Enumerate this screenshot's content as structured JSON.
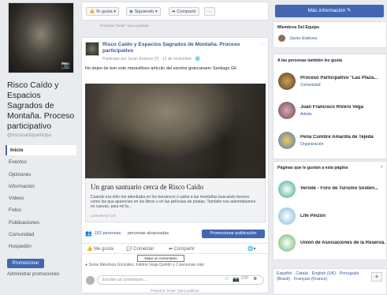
{
  "page": {
    "name": "Risco Caído y Espacios Sagrados de Montaña. Proceso participativo",
    "handle": "@riscocaidoparticipa"
  },
  "nav": [
    "Inicio",
    "Eventos",
    "Opiniones",
    "Información",
    "Vídeos",
    "Fotos",
    "Publicaciones",
    "Comunidad",
    "Hospedón"
  ],
  "left": {
    "promote": "Promocionar",
    "admin_promos": "Administrar promociones"
  },
  "topbar": {
    "like": "Te gusta ▾",
    "following": "Siguiendo ▾",
    "share": "Compartir",
    "more": "···"
  },
  "invite_hint": "Presiona \"Enter\" para publicar.",
  "post": {
    "title": "Risco Caído y Espacios Sagrados de Montaña. Proceso participativo",
    "meta": "Publicado por Javier Estévez [?] · 12 de noviembre · 🌐",
    "text": "No dejen de leer este maravilloso artículo del escritor grancanario Santiago Gil",
    "link_title": "Un gran santuario cerca de Risco Caído",
    "link_desc": "Cuando era niño me adentraba en los barrancos o subía a las montañas buscando tesoros como los que aparecían en los libros o en las películas de piratas. También nos adentrábamos en cuevas, para mí la...",
    "link_domain": "CANARIAS7.ES",
    "reach_count": "152 personas",
    "reach_label": "personas alcanzadas",
    "promote_pub": "Promocionar publicación",
    "like": "Me gusta",
    "comment": "Comentar",
    "share": "Compartir",
    "tooltip": "Dejar un comentario",
    "likers": "Sonia Mendoza González, Fátima Vega Quintín y 2 personas más",
    "comment_placeholder": "Escribe un comentario...",
    "invite_hint": "Presiona \"Enter\" para publicar."
  },
  "right": {
    "more_info": "Más información ✎",
    "team_head": "Miembros Del Equipo",
    "team_member": "Javier Estévez",
    "also_likes_head": "A las personas también les gusta",
    "also_likes": [
      {
        "name": "Proceso Participativo \"Las Plaza...",
        "sub": "Comunidad"
      },
      {
        "name": "Juan Francisco Rivero Vega",
        "sub": "Artista"
      },
      {
        "name": "Peña Cumbre Amarilla de Tejeda",
        "sub": "Organización"
      }
    ],
    "liked_by_head": "Páginas que le gustan a esta página",
    "liked_by": [
      {
        "name": "Verode - Foro de Turismo Sosten..."
      },
      {
        "name": "Life Pinzón"
      },
      {
        "name": "Unión de Asociaciones de la Reserva..."
      }
    ],
    "languages": "Español · Català · English (UK) · Português (Brasil) · Français (France)",
    "plus": "+"
  },
  "colors": {
    "brand": "#4267b2",
    "link": "#365899"
  }
}
